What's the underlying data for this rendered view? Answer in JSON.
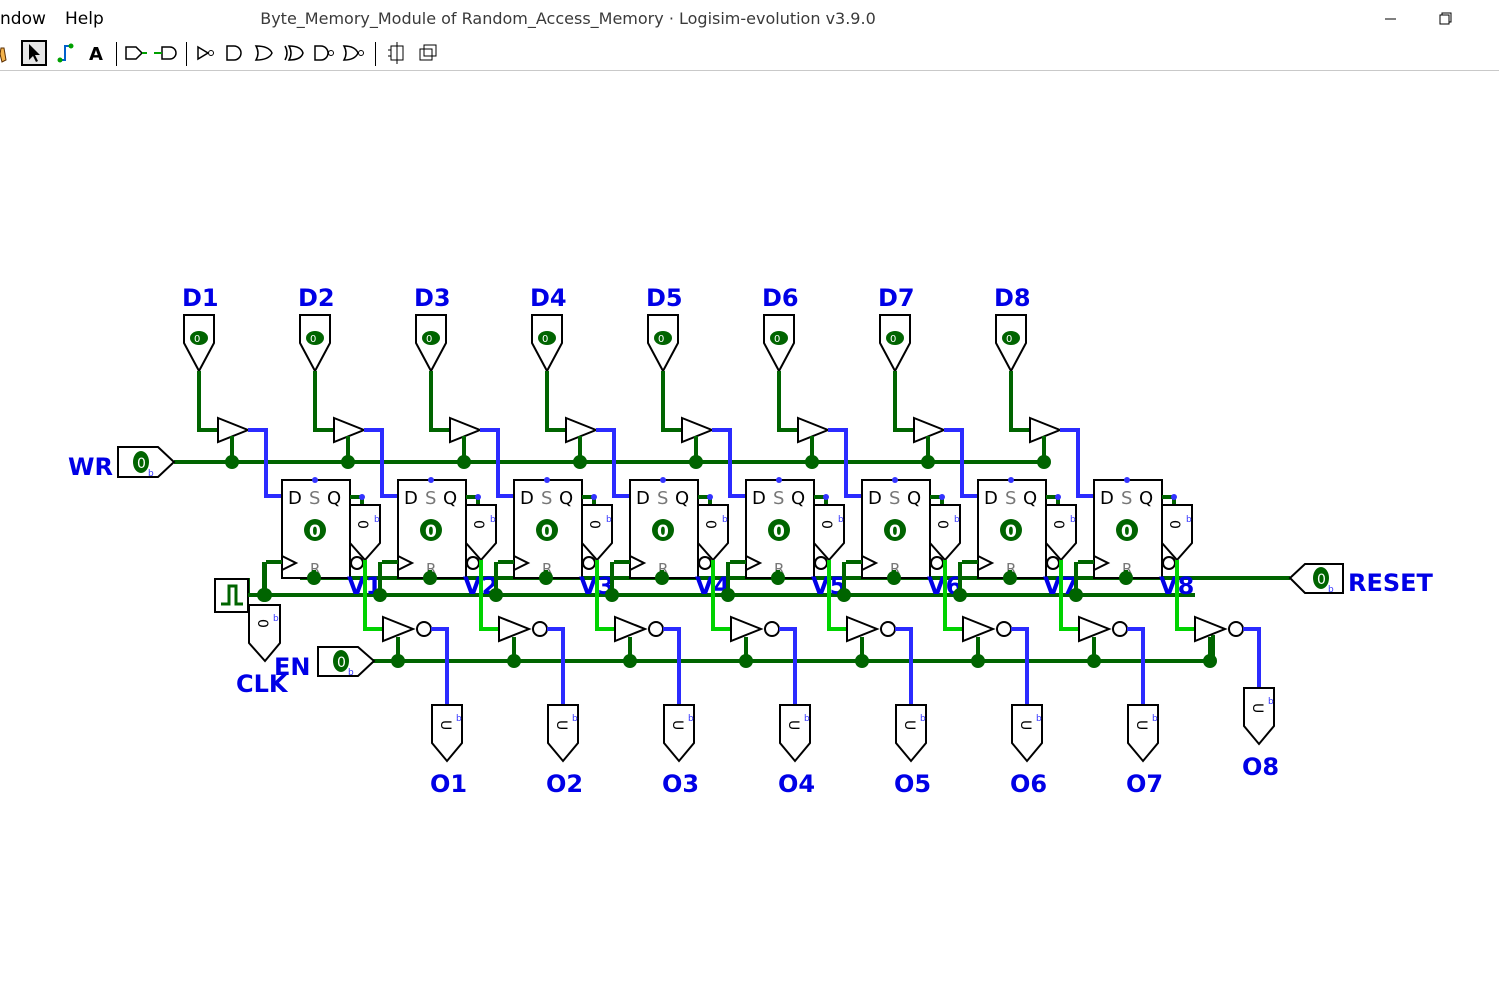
{
  "window": {
    "menus": [
      "ndow",
      "Help"
    ],
    "title": "Byte_Memory_Module of Random_Access_Memory · Logisim-evolution v3.9.0"
  },
  "toolbar": {
    "tools": [
      "hand-poke-tool",
      "select-tool",
      "wiring-tool",
      "text-tool",
      "pin-in-tool",
      "pin-out-tool",
      "not-gate-tool",
      "and-gate-tool",
      "or-gate-tool",
      "xor-gate-tool",
      "nand-gate-tool",
      "nor-gate-tool",
      "flip-horizontal-tool",
      "flip-vertical-tool"
    ],
    "selected": "select-tool"
  },
  "circuit": {
    "inputs": [
      "D1",
      "D2",
      "D3",
      "D4",
      "D5",
      "D6",
      "D7",
      "D8"
    ],
    "input_value": "0",
    "cells": [
      "V1",
      "V2",
      "V3",
      "V4",
      "V5",
      "V6",
      "V7",
      "V8"
    ],
    "outputs": [
      "O1",
      "O2",
      "O3",
      "O4",
      "O5",
      "O6",
      "O7",
      "O8"
    ],
    "out_value": "U",
    "probe_value": "0",
    "reg_value": "0",
    "wr_label": "WR",
    "en_label": "EN",
    "clk_label": "CLK",
    "reset_label": "RESET",
    "pin_value": "0",
    "radix": "b",
    "ff_labels": {
      "d": "D",
      "s": "S",
      "q": "Q",
      "r": "R"
    },
    "colors": {
      "wire": "#006400",
      "high": "#00d200",
      "bus": "#2b2bff",
      "label": "#0000e6"
    }
  }
}
